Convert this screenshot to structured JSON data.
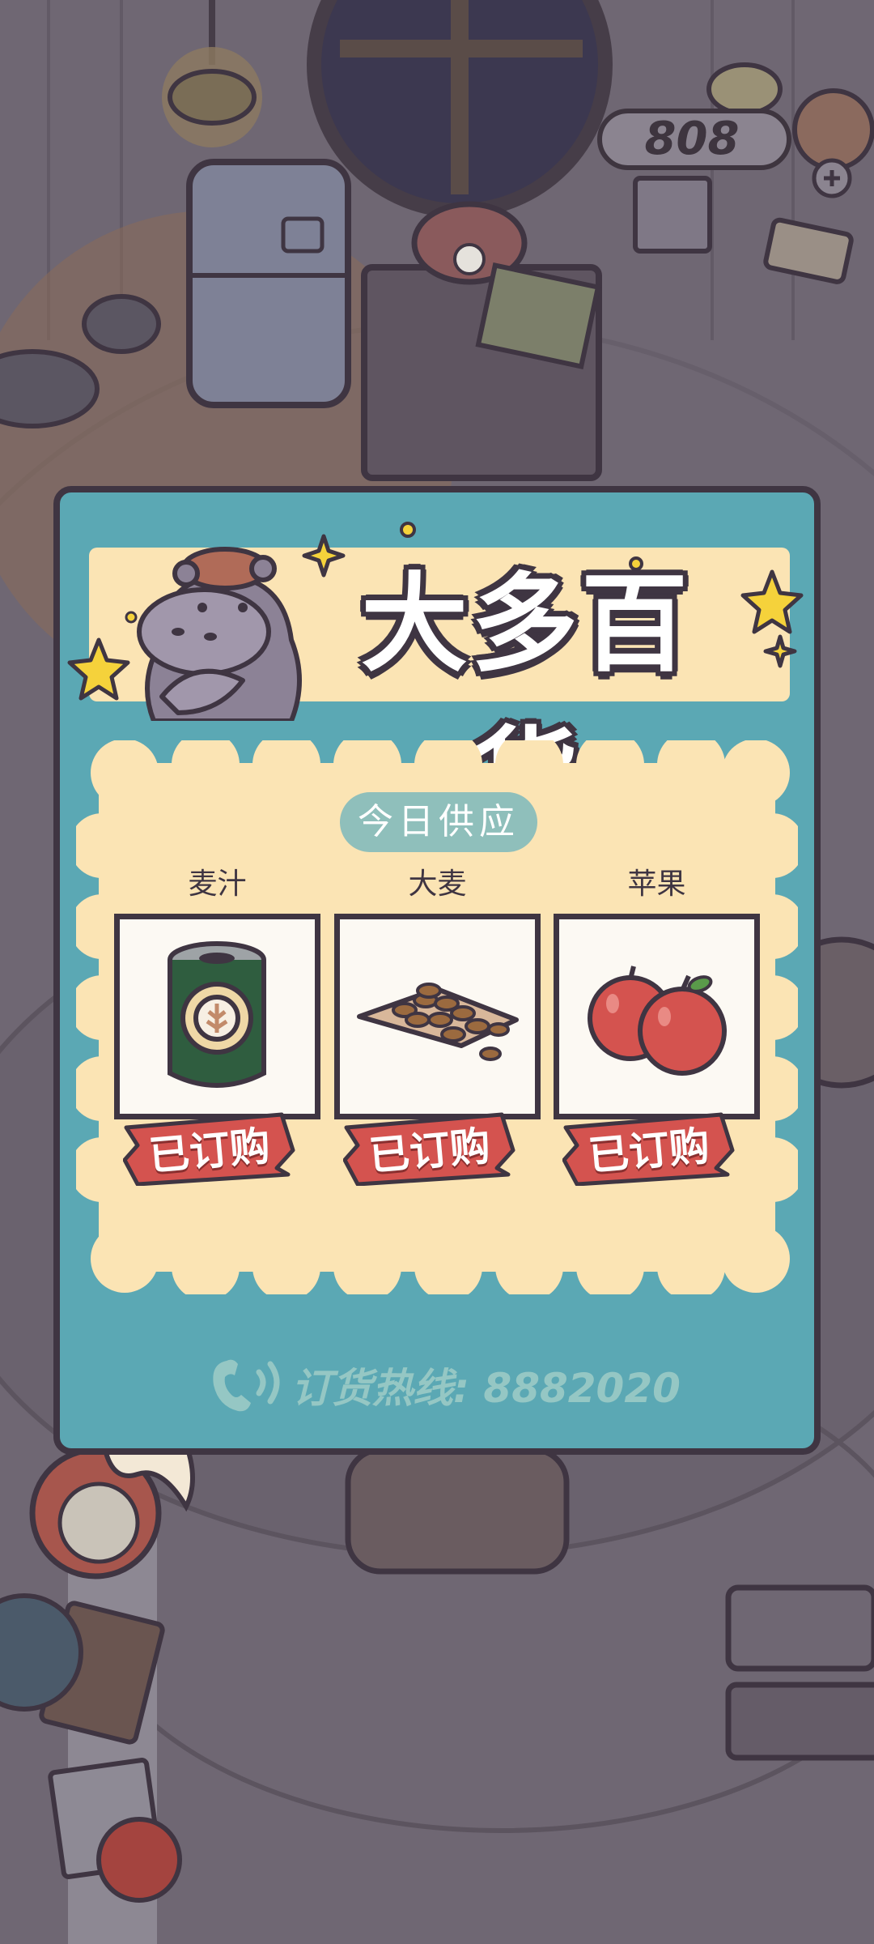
{
  "hud": {
    "coins": "808",
    "add_icon": "plus-icon",
    "mail_icon": "letter-icon"
  },
  "shop": {
    "title": "大多百货",
    "mascot_icon": "hippo-shopkeeper-icon",
    "section_label": "今日供应",
    "items": [
      {
        "name": "麦汁",
        "icon": "wort-can-icon",
        "status": "已订购"
      },
      {
        "name": "大麦",
        "icon": "barley-icon",
        "status": "已订购"
      },
      {
        "name": "苹果",
        "icon": "apple-icon",
        "status": "已订购"
      }
    ],
    "hotline_label": "订货热线: 8882020",
    "hotline_icon": "phone-icon"
  },
  "colors": {
    "panel": "#5ba8b4",
    "banner": "#fbe4b4",
    "tag": "#d4534f",
    "outline": "#3f3542",
    "overlay": "#6f6773"
  }
}
